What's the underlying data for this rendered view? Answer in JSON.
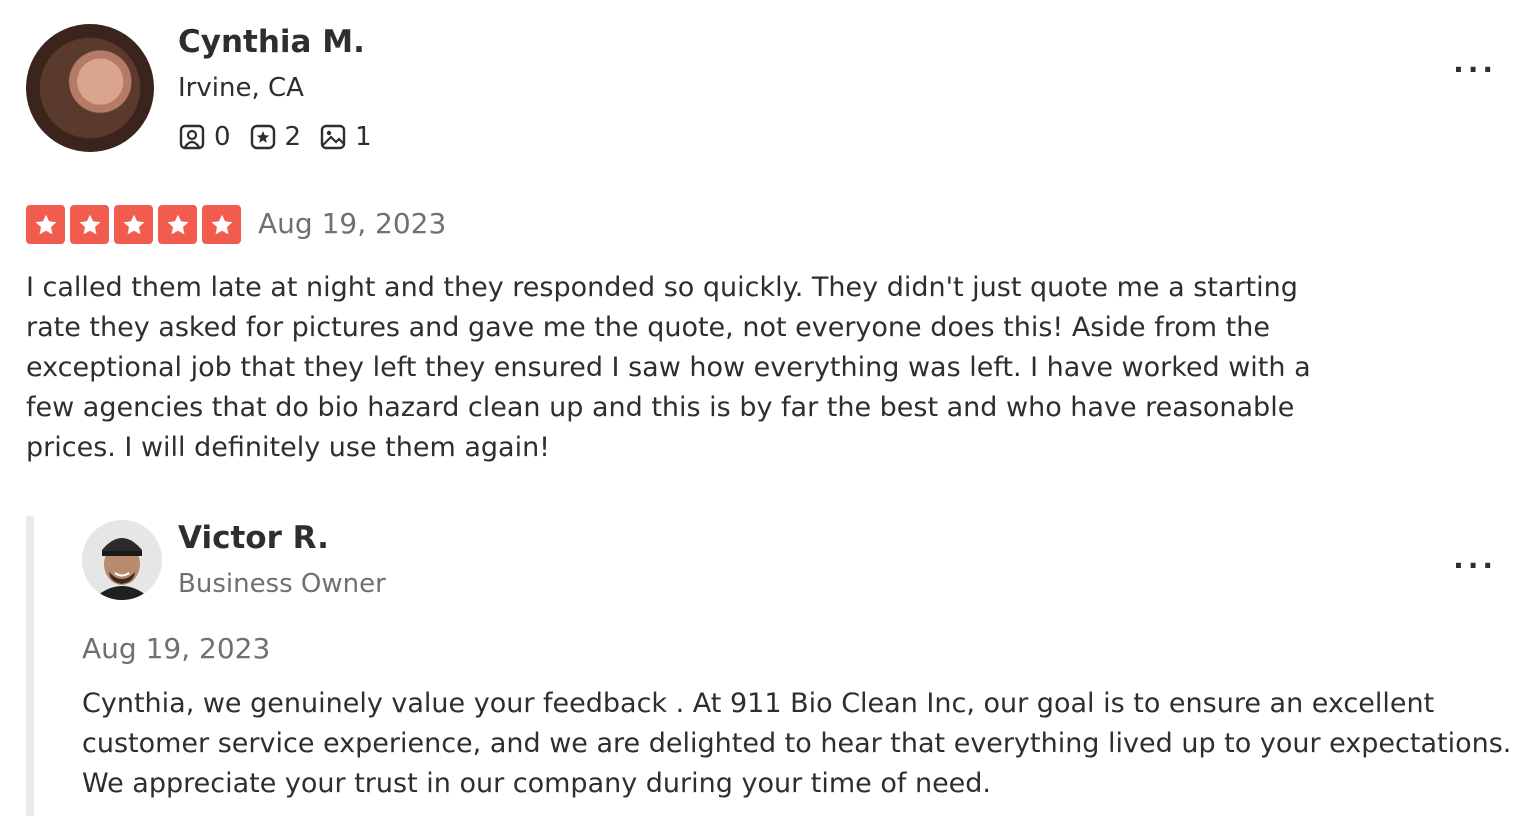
{
  "review": {
    "user": {
      "name": "Cynthia M.",
      "location": "Irvine, CA",
      "stats": {
        "friends": "0",
        "reviews": "2",
        "photos": "1"
      }
    },
    "rating": 5,
    "date": "Aug 19, 2023",
    "text": "I called them late at night and they responded so quickly. They didn't just quote me a starting rate they asked for pictures and gave me the quote, not everyone does this! Aside from the exceptional job that they left they ensured I saw how everything was left. I have worked with a few agencies that do bio hazard clean up and this is by far the best and who have reasonable prices. I will definitely use them again!",
    "more_label": "..."
  },
  "reply": {
    "owner": {
      "name": "Victor R.",
      "role": "Business Owner"
    },
    "date": "Aug 19, 2023",
    "text": "Cynthia, we genuinely value your feedback . At 911 Bio Clean Inc, our goal is to ensure an excellent customer service experience, and we are delighted to hear that everything lived up to your expectations. We appreciate your trust in our company during your time of need.",
    "more_label": "..."
  },
  "colors": {
    "star_red": "#f15c4f",
    "muted_text": "#6e7072",
    "text": "#2d2e2f"
  }
}
